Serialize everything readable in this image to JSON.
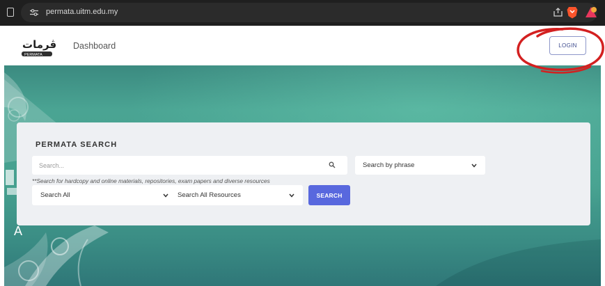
{
  "browser": {
    "url": "permata.uitm.edu.my",
    "icons": [
      "bookmark-icon",
      "site-settings-icon",
      "share-icon",
      "brave-shield-icon",
      "brave-rewards-icon"
    ]
  },
  "navbar": {
    "logo_text": "ڤرمات",
    "logo_subtext": "PERMATA",
    "dashboard_label": "Dashboard",
    "login_label": "LOGIN"
  },
  "hero": {
    "side_letter": "A"
  },
  "search": {
    "title": "PERMATA SEARCH",
    "placeholder": "Search...",
    "phrase_select": "Search by phrase",
    "note": "**Search for hardcopy and online materials, repositories, exam papers and diverse resources",
    "scope_select": "Search All",
    "resource_select": "Search All Resources",
    "search_button": "SEARCH"
  },
  "colors": {
    "browser_bar": "#1f1f1f",
    "hero_teal": "#46a08f",
    "search_button": "#5868de",
    "annotation_circle": "#d32020"
  }
}
